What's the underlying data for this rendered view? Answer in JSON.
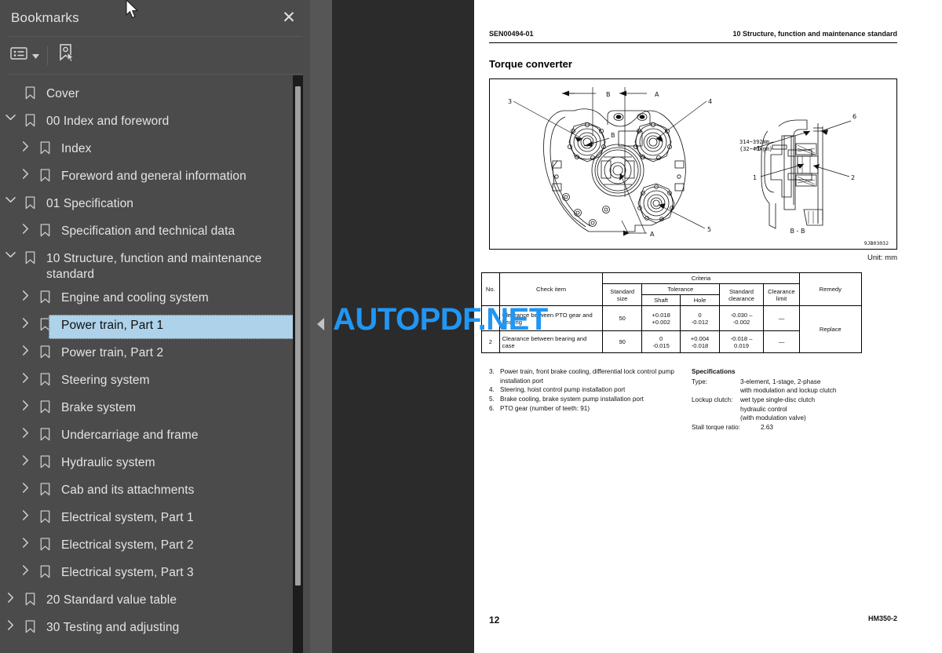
{
  "sidebar": {
    "title": "Bookmarks",
    "close_icon": "close-icon",
    "toolbar": {
      "options_label": "list-options-icon",
      "dropdown_label": "chevron-down-icon",
      "new_bookmark_label": "new-bookmark-icon"
    },
    "items": [
      {
        "label": "Cover",
        "depth": 1,
        "twisty": "none",
        "selected": false
      },
      {
        "label": "00 Index and foreword",
        "depth": 1,
        "twisty": "down",
        "selected": false
      },
      {
        "label": "Index",
        "depth": 2,
        "twisty": "right",
        "selected": false
      },
      {
        "label": "Foreword and general information",
        "depth": 2,
        "twisty": "right",
        "selected": false
      },
      {
        "label": "01 Specification",
        "depth": 1,
        "twisty": "down",
        "selected": false
      },
      {
        "label": "Specification and technical data",
        "depth": 2,
        "twisty": "right",
        "selected": false
      },
      {
        "label": "10 Structure, function and maintenance standard",
        "depth": 1,
        "twisty": "down",
        "selected": false
      },
      {
        "label": "Engine and cooling system",
        "depth": 2,
        "twisty": "right",
        "selected": false
      },
      {
        "label": "Power train, Part 1",
        "depth": 2,
        "twisty": "right",
        "selected": true
      },
      {
        "label": "Power train, Part 2",
        "depth": 2,
        "twisty": "right",
        "selected": false
      },
      {
        "label": "Steering system",
        "depth": 2,
        "twisty": "right",
        "selected": false
      },
      {
        "label": "Brake system",
        "depth": 2,
        "twisty": "right",
        "selected": false
      },
      {
        "label": "Undercarriage and frame",
        "depth": 2,
        "twisty": "right",
        "selected": false
      },
      {
        "label": "Hydraulic system",
        "depth": 2,
        "twisty": "right",
        "selected": false
      },
      {
        "label": "Cab and its attachments",
        "depth": 2,
        "twisty": "right",
        "selected": false
      },
      {
        "label": "Electrical system, Part 1",
        "depth": 2,
        "twisty": "right",
        "selected": false
      },
      {
        "label": "Electrical system, Part 2",
        "depth": 2,
        "twisty": "right",
        "selected": false
      },
      {
        "label": "Electrical system, Part 3",
        "depth": 2,
        "twisty": "right",
        "selected": false
      },
      {
        "label": "20 Standard value table",
        "depth": 1,
        "twisty": "right",
        "selected": false
      },
      {
        "label": "30 Testing and adjusting",
        "depth": 1,
        "twisty": "right",
        "selected": false
      }
    ]
  },
  "viewer": {
    "collapse_handle_icon": "collapse-left-icon",
    "watermark": {
      "part1": "AUTOPDF",
      "part2": ".NET",
      "color": "#2196f3"
    }
  },
  "page": {
    "header_left": "SEN00494-01",
    "header_right": "10 Structure, function and maintenance standard",
    "title": "Torque converter",
    "unit_note": "Unit: mm",
    "footer_page": "12",
    "footer_model": "HM350-2",
    "figure": {
      "drawing_id": "9JB03032",
      "section_label": "B - B",
      "torque_note_line1": "314~392Nm",
      "torque_note_line2": "{32~40kgm}",
      "callouts": [
        "3",
        "4",
        "5",
        "6",
        "1",
        "2"
      ],
      "section_marks": [
        "A",
        "B"
      ]
    },
    "table": {
      "headers_row1": [
        "No.",
        "Check item",
        "Criteria",
        "Remedy"
      ],
      "headers_row2": [
        "Standard size",
        "Tolerance",
        "Standard clearance",
        "Clearance limit"
      ],
      "headers_row3": [
        "Shaft",
        "Hole"
      ],
      "rows": [
        {
          "no": "1",
          "check_item": "Clearance between PTO gear and bearing",
          "standard_size": "50",
          "tolerance_shaft": "+0.018\n+0.002",
          "tolerance_hole": "0\n-0.012",
          "standard_clearance": "-0.030 –\n-0.002",
          "clearance_limit": "—",
          "remedy": "Replace"
        },
        {
          "no": "2",
          "check_item": "Clearance between bearing and case",
          "standard_size": "90",
          "tolerance_shaft": "0\n-0.015",
          "tolerance_hole": "+0.004\n-0.018",
          "standard_clearance": "-0.018 –\n0.019",
          "clearance_limit": "—",
          "remedy": ""
        }
      ]
    },
    "notes": [
      {
        "num": "3.",
        "text": "Power train, front brake cooling, differential lock control pump installation port"
      },
      {
        "num": "4.",
        "text": "Steering, hoist control pump installation port"
      },
      {
        "num": "5.",
        "text": "Brake cooling, brake system pump installation port"
      },
      {
        "num": "6.",
        "text": "PTO gear (number of teeth: 91)"
      }
    ],
    "specifications": {
      "heading": "Specifications",
      "rows": [
        {
          "key": "Type:",
          "value": "3-element, 1-stage, 2-phase\nwith modulation and lockup clutch"
        },
        {
          "key": "Lockup clutch:",
          "value": "wet type single-disc clutch\nhydraulic control\n(with modulation valve)"
        },
        {
          "key": "Stall torque ratio:",
          "value": "2.63",
          "inline": true
        }
      ]
    }
  }
}
